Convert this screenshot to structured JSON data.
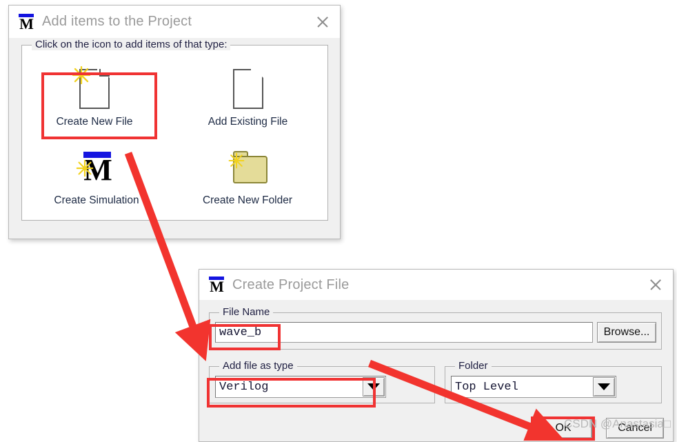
{
  "colors": {
    "annotation_red": "#f03333",
    "logo_blue": "#1414e0",
    "dialog_bg": "#f0f0f0",
    "titlebar_bg": "#ffffff",
    "title_text": "#9a9a9a",
    "folder_yellow": "#e4dc99",
    "watermark_grey": "#b9b9b9"
  },
  "dialog_add_items": {
    "title": "Add items to the Project",
    "logo_name": "modelsim-m-logo",
    "close_label": "✕",
    "group": {
      "legend": "Click on the icon to add items of that type:",
      "items": [
        {
          "label": "Create New File",
          "icon": "new-file-icon",
          "highlighted": true
        },
        {
          "label": "Add Existing File",
          "icon": "existing-file-icon",
          "highlighted": false
        },
        {
          "label": "Create Simulation",
          "icon": "create-simulation-icon",
          "highlighted": false
        },
        {
          "label": "Create New Folder",
          "icon": "new-folder-icon",
          "highlighted": false
        }
      ]
    }
  },
  "dialog_create_project_file": {
    "title": "Create Project File",
    "logo_name": "modelsim-m-logo",
    "close_label": "✕",
    "file_name": {
      "legend": "File Name",
      "value": "wave_b",
      "placeholder": "",
      "browse_label": "Browse...",
      "highlighted": true
    },
    "add_file_as_type": {
      "legend": "Add file as type",
      "value": "Verilog",
      "highlighted": true
    },
    "folder": {
      "legend": "Folder",
      "value": "Top Level",
      "highlighted": false
    },
    "buttons": {
      "ok_label": "OK",
      "cancel_label": "Cancel",
      "ok_highlighted": true
    }
  },
  "watermark": {
    "text": "CSDN @Anastasia□"
  },
  "annotations": {
    "arrow_1": "arrow from Create New File to wave_b field",
    "arrow_2": "arrow from Add file as type to OK button"
  }
}
